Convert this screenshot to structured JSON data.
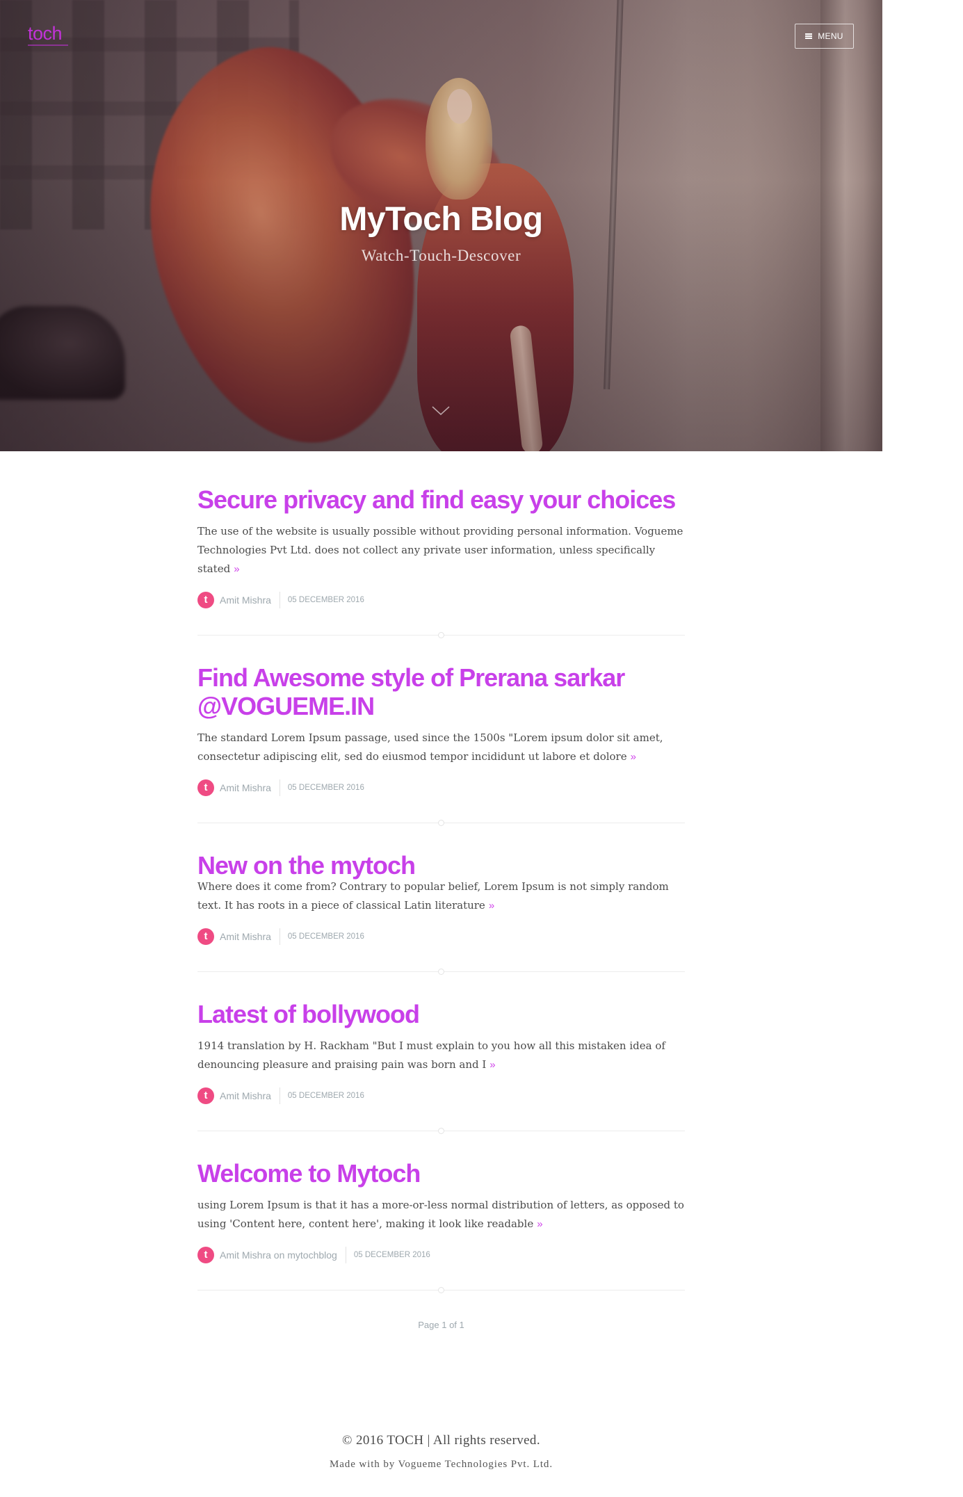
{
  "site": {
    "logo_text": "toch",
    "menu_label": "MENU",
    "title": "MyToch Blog",
    "subtitle": "Watch-Touch-Descover",
    "avatar_glyph": "t"
  },
  "colors": {
    "accent": "#c840e9",
    "avatar": "#ef4b83",
    "read_more": "#d044ea"
  },
  "icons": {
    "menu": "hamburger-icon",
    "scroll": "chevron-down-icon",
    "avatar": "author-avatar-icon"
  },
  "read_more": "»",
  "posts": [
    {
      "title": "Secure privacy and find easy your choices",
      "excerpt": "The use of the website is usually possible without providing personal information. Vogueme Technologies Pvt Ltd. does not collect any private user information, unless specifically stated",
      "author": "Amit Mishra",
      "date": "05 DECEMBER 2016"
    },
    {
      "title": "Find Awesome style of Prerana sarkar @VOGUEME.IN",
      "excerpt": "The standard Lorem Ipsum passage, used since the 1500s \"Lorem ipsum dolor sit amet, consectetur adipiscing elit, sed do eiusmod tempor incididunt ut labore et dolore",
      "author": "Amit Mishra",
      "date": "05 DECEMBER 2016"
    },
    {
      "title": "New on the mytoch",
      "excerpt": "Where does it come from? Contrary to popular belief, Lorem Ipsum is not simply random text. It has roots in a piece of classical Latin literature",
      "author": "Amit Mishra",
      "date": "05 DECEMBER 2016"
    },
    {
      "title": "Latest of bollywood",
      "excerpt": "1914 translation by H. Rackham \"But I must explain to you how all this mistaken idea of denouncing pleasure and praising pain was born and I",
      "author": "Amit Mishra",
      "date": "05 DECEMBER 2016"
    },
    {
      "title": "Welcome to Mytoch",
      "excerpt": "using Lorem Ipsum is that it has a more-or-less normal distribution of letters, as opposed to using 'Content here, content here', making it look like readable",
      "author": "Amit Mishra on mytochblog",
      "date": "05 DECEMBER 2016"
    }
  ],
  "pagination": "Page 1 of 1",
  "footer": {
    "copyright": "© 2016 TOCH | All rights reserved.",
    "credit": "Made with by Vogueme Technologies Pvt. Ltd."
  }
}
